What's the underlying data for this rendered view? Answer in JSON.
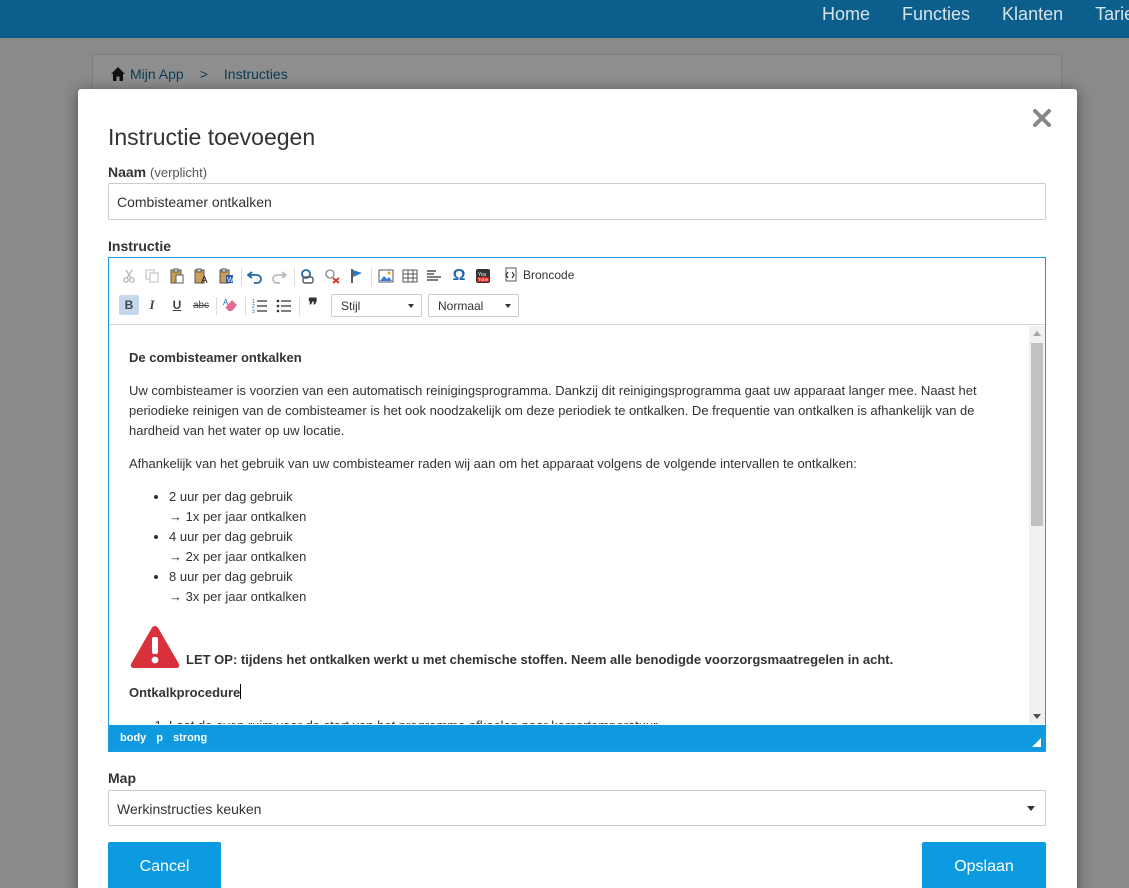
{
  "topnav": {
    "items": [
      "Home",
      "Functies",
      "Klanten",
      "Tarie"
    ]
  },
  "breadcrumb": {
    "home": "Mijn App",
    "separator": ">",
    "current": "Instructies"
  },
  "modal": {
    "title": "Instructie toevoegen",
    "name_label": "Naam",
    "name_hint": "(verplicht)",
    "name_value": "Combisteamer ontkalken",
    "instruction_label": "Instructie",
    "map_label": "Map",
    "map_value": "Werkinstructies keuken",
    "cancel_label": "Cancel",
    "save_label": "Opslaan"
  },
  "editor": {
    "toolbar": {
      "source_label": "Broncode",
      "style_dropdown": "Stijl",
      "format_dropdown": "Normaal",
      "bold": "B",
      "italic": "I",
      "underline": "U",
      "strike": "abc",
      "blockquote": "❞",
      "special_char": "Ω"
    },
    "content": {
      "heading": "De combisteamer ontkalken",
      "paragraph1": "Uw combisteamer is voorzien van een automatisch reinigingsprogramma. Dankzij dit reinigingsprogramma gaat uw apparaat langer mee. Naast het periodieke reinigen van de combisteamer is het ook noodzakelijk om deze periodiek te ontkalken. De frequentie van ontkalken is afhankelijk van de hardheid van het water op uw locatie.",
      "paragraph2": "Afhankelijk van het gebruik van uw combisteamer raden wij aan om het apparaat volgens de volgende intervallen te ontkalken:",
      "intervals": [
        {
          "usage": "2 uur per dag gebruik",
          "frequency": "→ 1x per jaar ontkalken"
        },
        {
          "usage": "4 uur per dag gebruik",
          "frequency": "→ 2x per jaar ontkalken"
        },
        {
          "usage": "8 uur per dag gebruik",
          "frequency": "→ 3x per jaar ontkalken"
        }
      ],
      "warning": "LET OP: tijdens het ontkalken werkt u met chemische stoffen. Neem alle benodigde voorzorgsmaatregelen in acht.",
      "procedure_heading": "Ontkalkprocedure",
      "procedure_step1": "Laat de oven ruim voor de start van het programma afkoelen naar kamertemperatuur"
    },
    "statusbar_path": [
      "body",
      "p",
      "strong"
    ]
  },
  "colors": {
    "accent": "#0c9be0",
    "topbar": "#0c5f8c",
    "warning_red": "#d9313c"
  }
}
